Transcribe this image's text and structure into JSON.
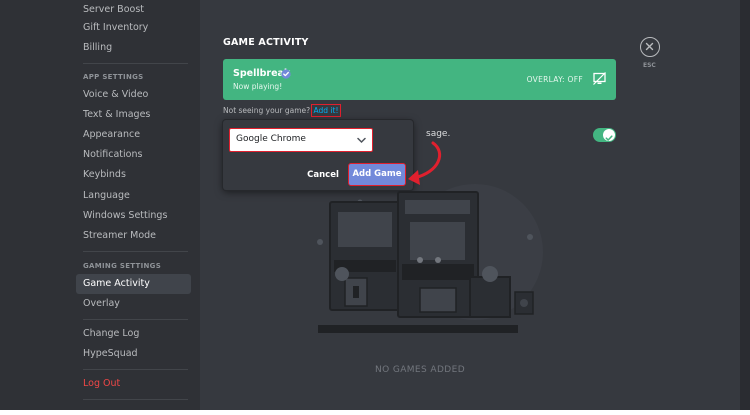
{
  "sidebar": {
    "items_top": [
      {
        "label": "Server Boost"
      },
      {
        "label": "Gift Inventory"
      },
      {
        "label": "Billing"
      }
    ],
    "app_settings_header": "APP SETTINGS",
    "app_settings": [
      {
        "label": "Voice & Video"
      },
      {
        "label": "Text & Images"
      },
      {
        "label": "Appearance"
      },
      {
        "label": "Notifications"
      },
      {
        "label": "Keybinds"
      },
      {
        "label": "Language"
      },
      {
        "label": "Windows Settings"
      },
      {
        "label": "Streamer Mode"
      }
    ],
    "gaming_settings_header": "GAMING SETTINGS",
    "gaming_settings": [
      {
        "label": "Game Activity",
        "selected": true
      },
      {
        "label": "Overlay"
      }
    ],
    "misc": [
      {
        "label": "Change Log"
      },
      {
        "label": "HypeSquad"
      }
    ],
    "logout_label": "Log Out"
  },
  "main": {
    "title": "GAME ACTIVITY",
    "current_game": {
      "name": "Spellbreak",
      "status": "Now playing!",
      "overlay_label": "OVERLAY: OFF"
    },
    "hint_text": "Not seeing your game?",
    "add_link": "Add it!",
    "behind_text_fragment": "sage.",
    "status_toggle_on": true,
    "popup": {
      "selected_game": "Google Chrome",
      "cancel_label": "Cancel",
      "add_game_label": "Add Game"
    },
    "esc_label": "ESC",
    "empty_label": "NO GAMES ADDED"
  },
  "colors": {
    "sidebar_bg": "#2f3136",
    "main_bg": "#36393f",
    "playing_green": "#43b581",
    "blurple": "#7289da",
    "link_blue": "#00b0f4",
    "danger_red": "#f04747",
    "annotation_red": "#e0202e"
  },
  "icons": {
    "verified": "check-badge-icon",
    "overlay": "monitor-icon",
    "dropdown": "chevron-down-icon",
    "close": "close-icon",
    "toggle": "checkmark-icon"
  }
}
